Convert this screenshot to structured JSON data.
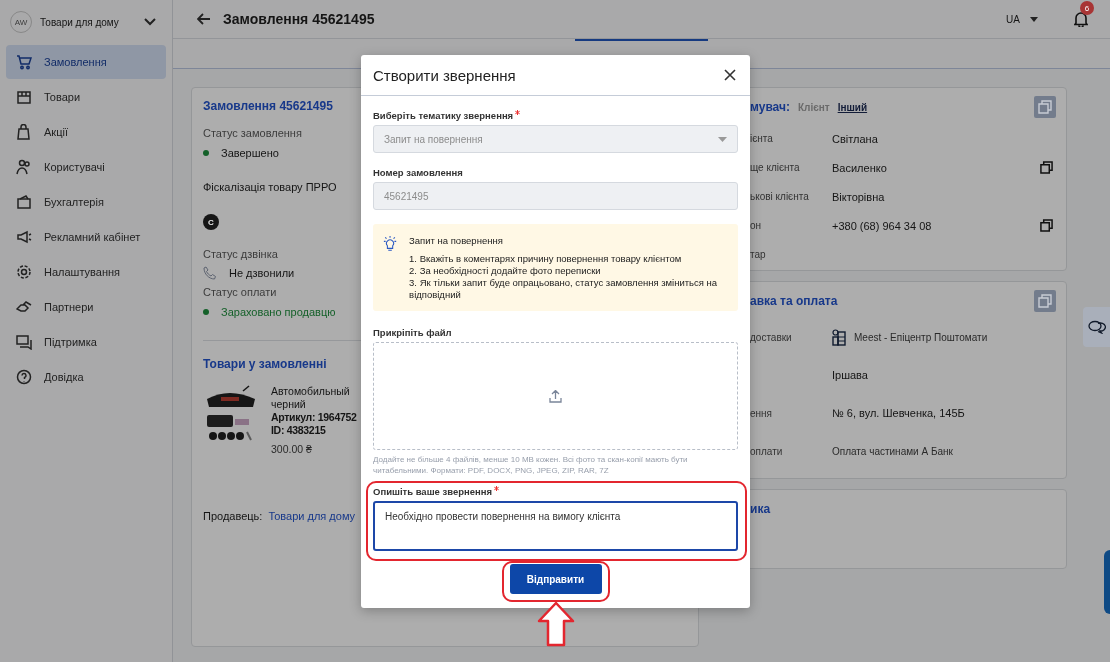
{
  "sidebar": {
    "account": {
      "avatar": "AW",
      "name": "Товари для дому"
    },
    "items": [
      {
        "label": "Замовлення",
        "selected": true
      },
      {
        "label": "Товари",
        "selected": false
      },
      {
        "label": "Акції",
        "selected": false
      },
      {
        "label": "Користувачі",
        "selected": false
      },
      {
        "label": "Бухгалтерія",
        "selected": false
      },
      {
        "label": "Рекламний кабінет",
        "selected": false
      },
      {
        "label": "Налаштування",
        "selected": false
      },
      {
        "label": "Партнери",
        "selected": false
      },
      {
        "label": "Підтримка",
        "selected": false
      },
      {
        "label": "Довідка",
        "selected": false
      }
    ]
  },
  "header": {
    "title": "Замовлення 45621495",
    "language": "UA",
    "notifications": "6"
  },
  "order_card": {
    "title": "Замовлення 45621495",
    "order_status_label": "Статус замовлення",
    "order_status": {
      "text": "Завершено",
      "color": "#146029"
    },
    "fiscal_label": "Фіскалізація товару ПРРО",
    "fiscal_badge": "С",
    "call_status_label": "Статус дзвінка",
    "call_status": "Не дзвонили",
    "payment_status_label": "Статус оплати",
    "payment_status": {
      "text": "Зараховано продавцю",
      "color": "#146029"
    },
    "products_title": "Товари у замовленні",
    "product": {
      "kind": "picture",
      "name_lines": [
        "Автомобильный",
        "черний"
      ],
      "article": "Артикул: 1964752",
      "id": "ID: 4383215",
      "price": "300.00 ₴"
    },
    "seller_label": "Продавець:",
    "seller": "Товари для дому"
  },
  "customer_card": {
    "title": "мувач:",
    "options": [
      {
        "label": "Клієнт",
        "selected": false
      },
      {
        "label": "Інший",
        "selected": true
      }
    ],
    "rows": [
      {
        "label": "ієнта",
        "value": "Світлана",
        "copy": false
      },
      {
        "label": "ще клієнта",
        "value": "Василенко",
        "copy": true
      },
      {
        "label": "ькові клієнта",
        "value": "Вікторівна",
        "copy": false
      },
      {
        "label": "он",
        "value": "+380 (68) 964 34 08",
        "copy": true
      },
      {
        "label": "тар",
        "copy": false
      }
    ]
  },
  "delivery_card": {
    "title": "авка та оплата",
    "rows": [
      {
        "label": "доставки",
        "value": "Meest - Епіцентр Поштомати",
        "kind": "carrier"
      },
      {
        "value": "Іршава",
        "kind": "plain"
      },
      {
        "label": "ення",
        "value": "№ 6, вул. Шевченка, 145Б",
        "kind": "plain"
      },
      {
        "label": "оплати",
        "value": "Оплата частинами А Банк",
        "kind": "small"
      }
    ]
  },
  "third_card": {
    "title": "ика"
  },
  "modal": {
    "title": "Створити звернення",
    "topic": {
      "label": "Виберіть тематику звернення",
      "required": true,
      "value": "Запит на повернення",
      "disabled": true
    },
    "order_number": {
      "label": "Номер замовлення",
      "value": "45621495",
      "disabled": true
    },
    "info": {
      "title": "Запит на повернення",
      "lines": [
        "1. Вкажіть в коментарях причину повернення товару клієнтом",
        "2. За необхідності додайте фото переписки",
        "3. Як тільки запит буде опрацьовано, статус замовлення зміниться на відповідний"
      ]
    },
    "attach_label": "Прикріпіть файл",
    "attach_hint": "Додайте не більше 4 файлів, менше 10 MB кожен. Всі фото та скан-копії мають бути читабельними. Формати: PDF, DOCX, PNG, JPEG, ZIP, RAR, 7Z",
    "description": {
      "label": "Опишіть ваше звернення",
      "required": true,
      "value": "Необхідно провести повернення на вимогу клієнта",
      "focused": true
    },
    "submit": "Відправити"
  }
}
